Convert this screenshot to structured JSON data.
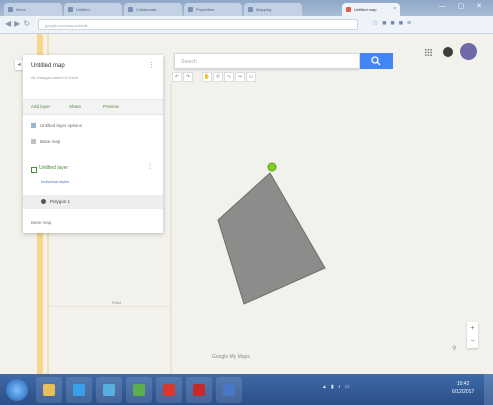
{
  "browser": {
    "tabs": [
      {
        "label": "Inbox"
      },
      {
        "label": "Untitled"
      },
      {
        "label": "Collaborate"
      },
      {
        "label": "Properties"
      },
      {
        "label": "Mapping"
      },
      {
        "label": "Untitled map",
        "active": true
      }
    ],
    "address": "google.com/maps/d/edit",
    "window_controls": "— ▢ ✕"
  },
  "maps": {
    "search_placeholder": "Search",
    "panel": {
      "title": "Untitled map",
      "subtitle": "All changes saved in Drive",
      "actions": [
        "Add layer",
        "Share",
        "Preview"
      ],
      "rows": [
        "Untitled layer options",
        "Base map"
      ],
      "layer_name": "Untitled layer",
      "style_link": "Individual styles",
      "item_label": "Polygon 1",
      "base_label": "Base map"
    },
    "map_label": "Field",
    "attribution": "Google My Maps",
    "zoom": {
      "in": "+",
      "out": "−"
    }
  },
  "taskbar": {
    "clock_time": "10:42",
    "clock_date": "6/12/2017"
  },
  "colors": {
    "polygon_fill": "#8c8c8a",
    "marker": "#7ed321",
    "accent": "#4285f4",
    "taskbar": "#2f5b96"
  }
}
